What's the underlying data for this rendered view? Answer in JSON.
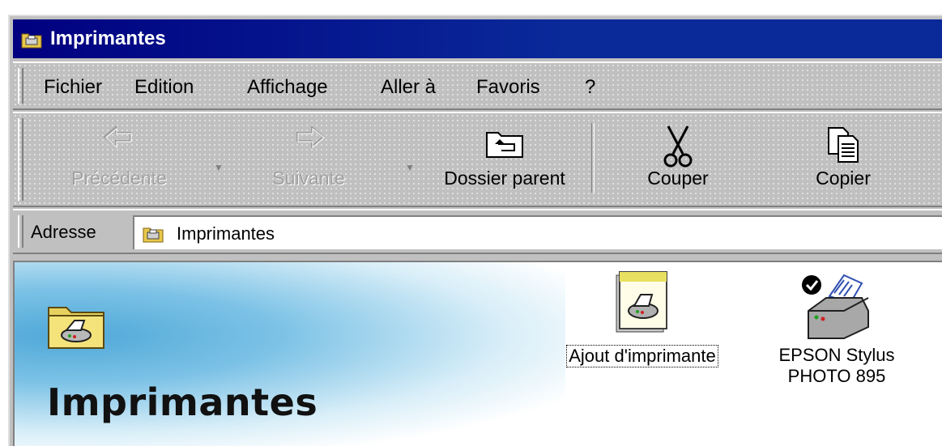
{
  "window": {
    "title": "Imprimantes"
  },
  "menu": [
    {
      "label": "Fichier"
    },
    {
      "label": "Edition"
    },
    {
      "label": "Affichage"
    },
    {
      "label": "Aller à"
    },
    {
      "label": "Favoris"
    },
    {
      "label": "?"
    }
  ],
  "toolbar": {
    "back": {
      "label": "Précédente",
      "icon": "back-arrow-icon",
      "enabled": false
    },
    "forward": {
      "label": "Suivante",
      "icon": "forward-arrow-icon",
      "enabled": false
    },
    "up": {
      "label": "Dossier parent",
      "icon": "folder-up-icon",
      "enabled": true
    },
    "cut": {
      "label": "Couper",
      "icon": "scissors-icon",
      "enabled": true
    },
    "copy": {
      "label": "Copier",
      "icon": "copy-icon",
      "enabled": true
    }
  },
  "address": {
    "label": "Adresse",
    "value": "Imprimantes",
    "icon": "printers-folder-icon"
  },
  "content": {
    "banner_title": "Imprimantes",
    "items": [
      {
        "label": "Ajout d'imprimante",
        "icon": "add-printer-icon",
        "focused": true
      },
      {
        "label_line1": "EPSON Stylus",
        "label_line2": "PHOTO 895",
        "icon": "default-printer-icon",
        "focused": false
      }
    ]
  },
  "colors": {
    "titlebar": "#000080",
    "chrome": "#c0c0c0",
    "disabled_text": "#a0a0a0"
  }
}
